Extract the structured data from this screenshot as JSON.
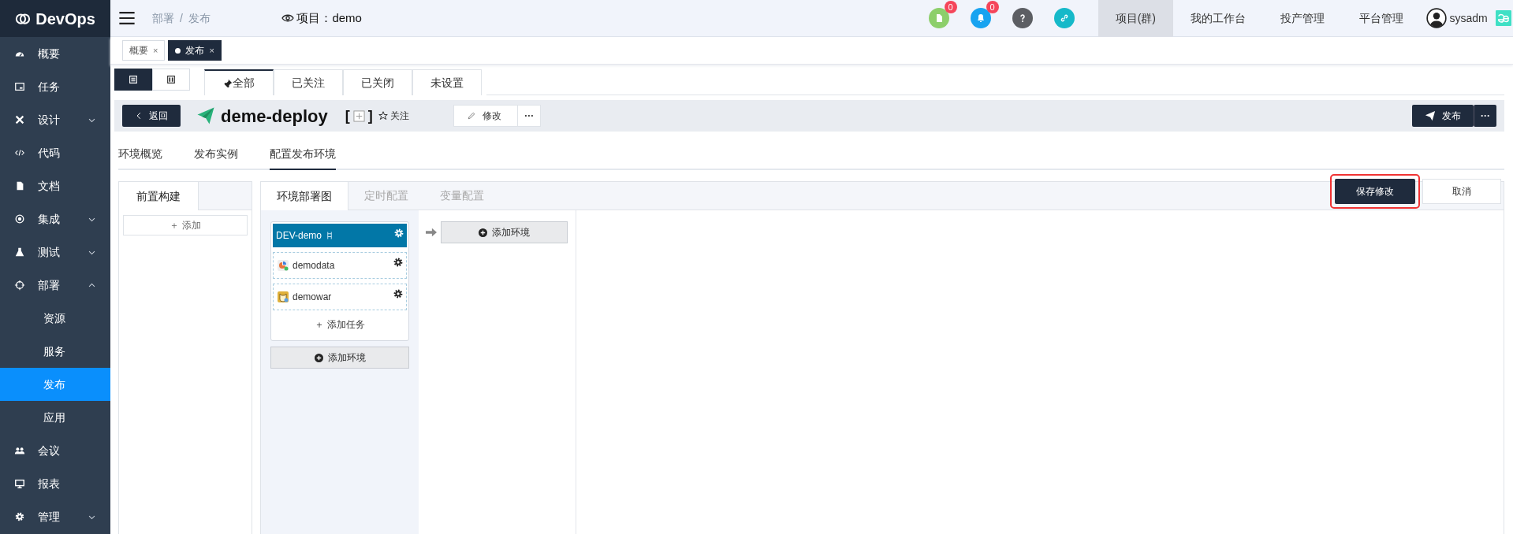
{
  "sidebar": {
    "logo": "DevOps",
    "items": [
      {
        "label": "概要",
        "kind": "item",
        "selected": false
      },
      {
        "label": "任务",
        "kind": "item",
        "selected": false
      },
      {
        "label": "设计",
        "kind": "group",
        "expanded": false,
        "selected": false
      },
      {
        "label": "代码",
        "kind": "item",
        "selected": false
      },
      {
        "label": "文档",
        "kind": "item",
        "selected": false
      },
      {
        "label": "集成",
        "kind": "group",
        "expanded": false,
        "selected": false
      },
      {
        "label": "测试",
        "kind": "group",
        "expanded": false,
        "selected": false
      },
      {
        "label": "部署",
        "kind": "group",
        "expanded": true,
        "selected": false,
        "children": [
          {
            "label": "资源",
            "selected": false
          },
          {
            "label": "服务",
            "selected": false
          },
          {
            "label": "发布",
            "selected": true
          },
          {
            "label": "应用",
            "selected": false
          }
        ]
      },
      {
        "label": "会议",
        "kind": "item",
        "selected": false
      },
      {
        "label": "报表",
        "kind": "item",
        "selected": false
      },
      {
        "label": "管理",
        "kind": "group",
        "expanded": false,
        "selected": false
      }
    ]
  },
  "header": {
    "breadcrumb": [
      "部署",
      "发布"
    ],
    "breadcrumb_separator": "/",
    "project": "项目：demo",
    "icon_buttons": [
      {
        "kind": "document",
        "badge": "0"
      },
      {
        "kind": "bell",
        "badge": "0"
      },
      {
        "kind": "help"
      },
      {
        "kind": "link"
      }
    ],
    "nav": [
      {
        "label": "项目(群)",
        "selected": true
      },
      {
        "label": "我的工作台",
        "selected": false
      },
      {
        "label": "投产管理",
        "selected": false
      },
      {
        "label": "平台管理",
        "selected": false
      }
    ],
    "user": "sysadm"
  },
  "page_tabs": [
    {
      "label": "概要",
      "close": "×",
      "selected": false
    },
    {
      "label": "发布",
      "close": "×",
      "selected": true
    }
  ],
  "view_toggles": [
    {
      "selected": true
    },
    {
      "selected": false
    }
  ],
  "filter_tabs": [
    {
      "label": "全部",
      "selected": true
    },
    {
      "label": "已关注",
      "selected": false
    },
    {
      "label": "已关闭",
      "selected": false
    },
    {
      "label": "未设置",
      "selected": false
    }
  ],
  "title_bar": {
    "back": "返回",
    "title": "deme-deploy",
    "bracket_open": "[",
    "bracket_close": "]",
    "follow": "关注",
    "edit": "修改",
    "more": "···",
    "publish": "发布",
    "publish_more": "···"
  },
  "sub_tabs": [
    {
      "label": "环境概览",
      "selected": false
    },
    {
      "label": "发布实例",
      "selected": false
    },
    {
      "label": "配置发布环境",
      "selected": true
    }
  ],
  "pre_build": {
    "tabs": [
      {
        "label": "前置构建",
        "selected": true
      }
    ],
    "add": "＋ 添加"
  },
  "config": {
    "tabs": [
      {
        "label": "环境部署图",
        "selected": true
      },
      {
        "label": "定时配置",
        "selected": false
      },
      {
        "label": "变量配置",
        "selected": false
      }
    ],
    "save": {
      "label": "保存修改",
      "highlighted": true
    },
    "cancel": "取消",
    "environments": [
      {
        "name": "DEV-demo",
        "tasks": [
          {
            "name": "demodata"
          },
          {
            "name": "demowar"
          }
        ],
        "add_task": "＋ 添加任务"
      }
    ],
    "add_environment": "添加环境",
    "add_environment_below": "添加环境"
  }
}
